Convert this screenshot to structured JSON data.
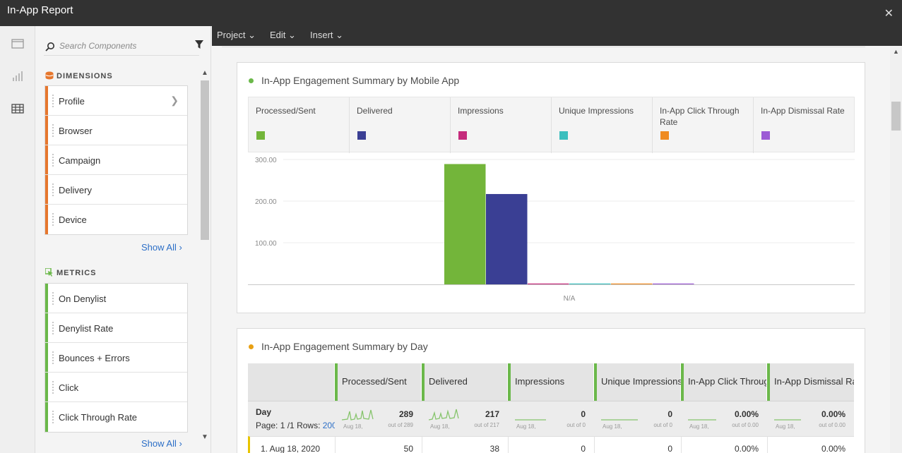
{
  "window": {
    "title": "In-App Report",
    "close_icon": "close-icon"
  },
  "menu": {
    "project": "Project",
    "edit": "Edit",
    "insert": "Insert"
  },
  "panel": {
    "search_placeholder": "Search Components",
    "dimensions_header": "DIMENSIONS",
    "dimensions": [
      "Profile",
      "Browser",
      "Campaign",
      "Delivery",
      "Device"
    ],
    "show_all": "Show All",
    "metrics_header": "METRICS",
    "metrics": [
      "On Denylist",
      "Denylist Rate",
      "Bounces + Errors",
      "Click",
      "Click Through Rate"
    ],
    "show_all_2": "Show All"
  },
  "colors": {
    "dimension_accent": "#e6772e",
    "metric_accent": "#6bb84a",
    "processed": "#73b53a",
    "delivered": "#3a3f94",
    "impressions": "#c52b7c",
    "unique_impressions": "#3bbfbe",
    "click_through": "#ef8b21",
    "dismissal": "#9c5bd5"
  },
  "card1": {
    "title": "In-App Engagement Summary by Mobile App",
    "legend": [
      "Processed/Sent",
      "Delivered",
      "Impressions",
      "Unique Impressions",
      "In-App Click Through Rate",
      "In-App Dismissal Rate"
    ]
  },
  "chart_data": {
    "type": "bar",
    "title": "In-App Engagement Summary by Mobile App",
    "categories": [
      "N/A"
    ],
    "ylim": [
      0,
      300
    ],
    "yticks": [
      "100.00",
      "200.00",
      "300.00"
    ],
    "series": [
      {
        "name": "Processed/Sent",
        "values": [
          289
        ]
      },
      {
        "name": "Delivered",
        "values": [
          217
        ]
      },
      {
        "name": "Impressions",
        "values": [
          0
        ]
      },
      {
        "name": "Unique Impressions",
        "values": [
          0
        ]
      },
      {
        "name": "In-App Click Through Rate",
        "values": [
          0
        ]
      },
      {
        "name": "In-App Dismissal Rate",
        "values": [
          0
        ]
      }
    ],
    "legend": "top",
    "grid": true
  },
  "card2": {
    "title": "In-App Engagement Summary by Day",
    "columns": [
      "Processed/Sent",
      "Delivered",
      "Impressions",
      "Unique Impressions",
      "In-App Click Throug",
      "In-App Dismissal Ra"
    ],
    "row_header": "Day",
    "page_label": "Page:",
    "page_value": "1 /1",
    "rows_label": "Rows:",
    "rows_value": "200",
    "summary": [
      {
        "value": "289",
        "of": "out of 289",
        "date": "Aug 18,"
      },
      {
        "value": "217",
        "of": "out of 217",
        "date": "Aug 18,"
      },
      {
        "value": "0",
        "of": "out of 0",
        "date": "Aug 18,"
      },
      {
        "value": "0",
        "of": "out of 0",
        "date": "Aug 18,"
      },
      {
        "value": "0.00%",
        "of": "out of 0.00",
        "date": "Aug 18,"
      },
      {
        "value": "0.00%",
        "of": "out of 0.00",
        "date": "Aug 18,"
      }
    ],
    "row1": {
      "label": "1. Aug 18, 2020",
      "values": [
        "50",
        "38",
        "0",
        "0",
        "0.00%",
        "0.00%"
      ]
    }
  }
}
